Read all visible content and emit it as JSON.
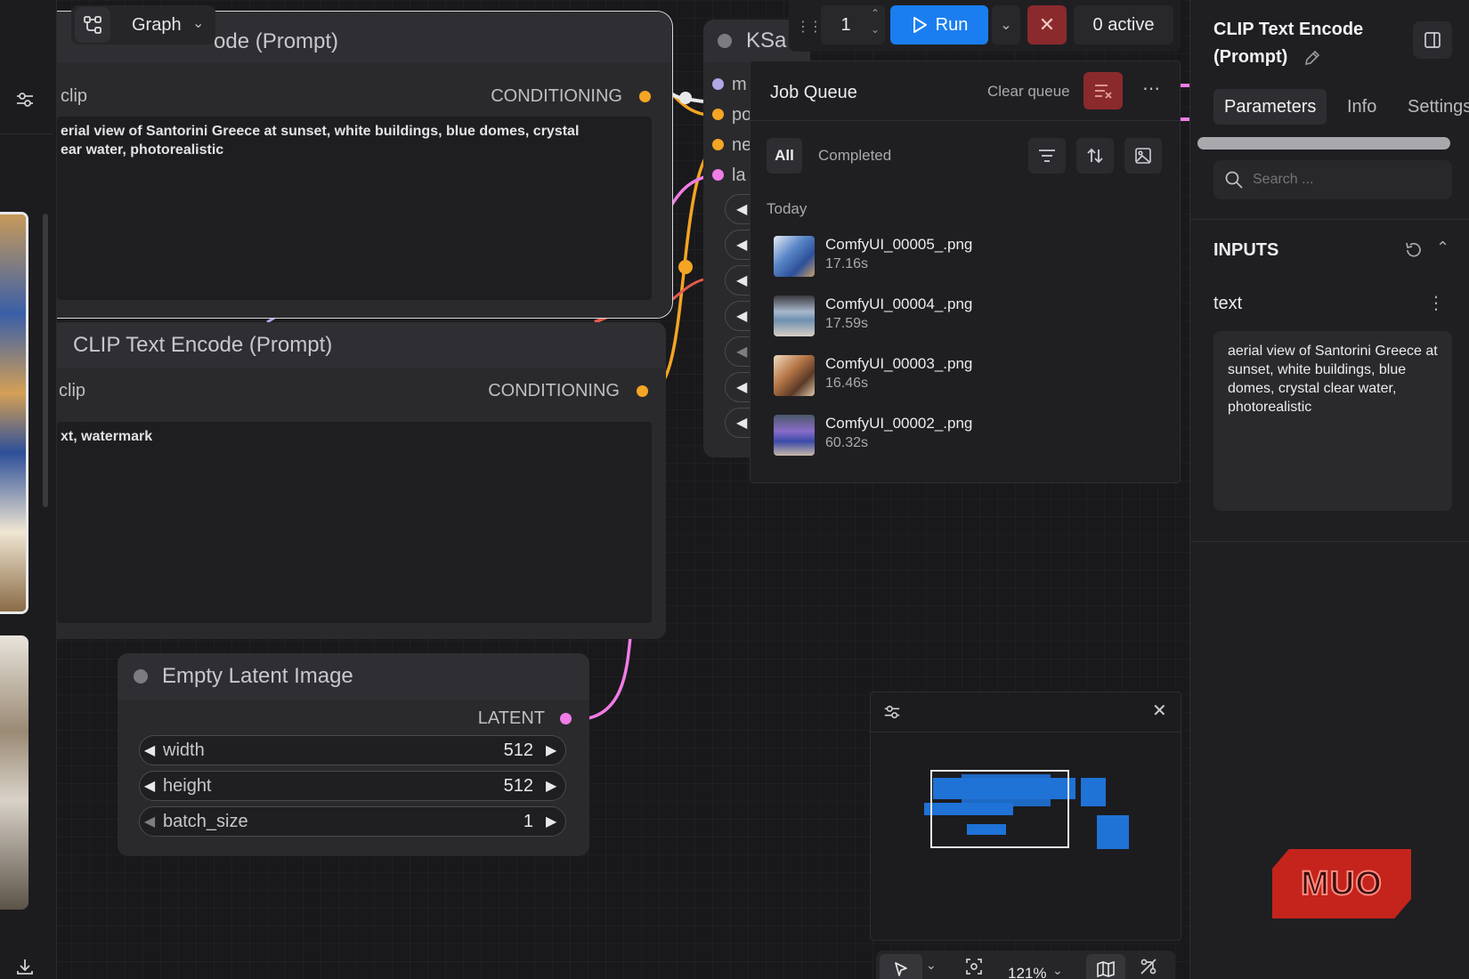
{
  "header": {
    "graph_label": "Graph"
  },
  "toolbar": {
    "queue_count": "1",
    "run_label": "Run",
    "active_label": "0 active"
  },
  "nodes": {
    "clip_top": {
      "title_fragment": "ode (Prompt)",
      "input_label": "clip",
      "output_label": "CONDITIONING",
      "text": "erial view of Santorini Greece at sunset, white buildings, blue domes, crystal\near water, photorealistic"
    },
    "clip_bottom": {
      "title": "CLIP Text Encode (Prompt)",
      "input_label": "clip",
      "output_label": "CONDITIONING",
      "text": "xt, watermark"
    },
    "ksampler": {
      "title_fragment": "KSa",
      "inputs": [
        "m",
        "po",
        "ne",
        "la"
      ]
    },
    "empty_latent": {
      "title": "Empty Latent Image",
      "output_label": "LATENT",
      "widgets": [
        {
          "label": "width",
          "value": "512"
        },
        {
          "label": "height",
          "value": "512"
        },
        {
          "label": "batch_size",
          "value": "1"
        }
      ]
    }
  },
  "job_queue": {
    "title": "Job Queue",
    "clear_label": "Clear queue",
    "filters": {
      "all": "All",
      "completed": "Completed"
    },
    "group_label": "Today",
    "items": [
      {
        "name": "ComfyUI_00005_.png",
        "time": "17.16s"
      },
      {
        "name": "ComfyUI_00004_.png",
        "time": "17.59s"
      },
      {
        "name": "ComfyUI_00003_.png",
        "time": "16.46s"
      },
      {
        "name": "ComfyUI_00002_.png",
        "time": "60.32s"
      }
    ]
  },
  "right_panel": {
    "title_line1": "CLIP Text Encode",
    "title_line2": "(Prompt)",
    "tabs": [
      "Parameters",
      "Info",
      "Settings"
    ],
    "search_placeholder": "Search ...",
    "inputs_header": "INPUTS",
    "field_label": "text",
    "field_value": "aerial view of Santorini Greece at sunset, white buildings, blue domes, crystal clear water, photorealistic"
  },
  "bottom_bar": {
    "zoom": "121%"
  },
  "watermark": {
    "text": "MUO"
  },
  "colors": {
    "accent_blue": "#1a7ef0",
    "cancel_red": "#8a2a2d",
    "conditioning_orange": "#f5a524",
    "latent_pink": "#f07ce6",
    "model_lavender": "#b3a7e8"
  }
}
